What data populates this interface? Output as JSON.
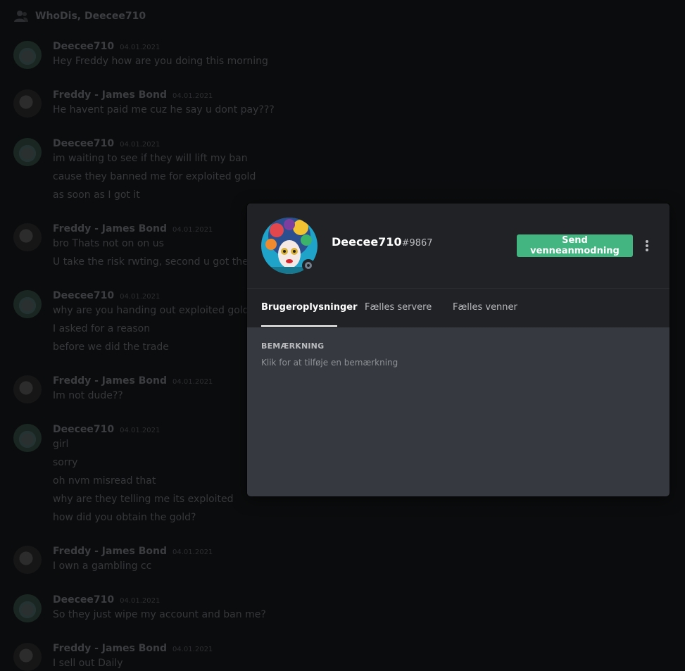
{
  "chat": {
    "header_title": "WhoDis, Deecee710",
    "messages": [
      {
        "author": "Deecee710",
        "time": "04.01.2021",
        "avatar": "deecee",
        "lines": [
          "Hey Freddy how are you doing this morning"
        ]
      },
      {
        "author": "Freddy - James Bond",
        "time": "04.01.2021",
        "avatar": "freddy",
        "lines": [
          "He havent paid me cuz he say u dont pay???"
        ]
      },
      {
        "author": "Deecee710",
        "time": "04.01.2021",
        "avatar": "deecee",
        "lines": [
          "im waiting to see if they will lift my ban",
          "cause they banned me for exploited gold",
          "as soon as I got it"
        ]
      },
      {
        "author": "Freddy - James Bond",
        "time": "04.01.2021",
        "avatar": "freddy",
        "lines": [
          "bro Thats not on on us",
          "U take the risk rwting, second u got the m"
        ]
      },
      {
        "author": "Deecee710",
        "time": "04.01.2021",
        "avatar": "deecee",
        "lines": [
          "why are you handing out exploited gold th",
          "I asked for a reason",
          "before we did the trade"
        ]
      },
      {
        "author": "Freddy - James Bond",
        "time": "04.01.2021",
        "avatar": "freddy",
        "lines": [
          "Im not dude??"
        ]
      },
      {
        "author": "Deecee710",
        "time": "04.01.2021",
        "avatar": "deecee",
        "lines": [
          "girl",
          "sorry",
          "oh nvm misread that",
          "why are they telling me its exploited",
          "how did you obtain the gold?"
        ]
      },
      {
        "author": "Freddy - James Bond",
        "time": "04.01.2021",
        "avatar": "freddy",
        "lines": [
          "I own a gambling cc"
        ]
      },
      {
        "author": "Deecee710",
        "time": "04.01.2021",
        "avatar": "deecee",
        "lines": [
          "So they just wipe my account and ban me?"
        ]
      },
      {
        "author": "Freddy - James Bond",
        "time": "04.01.2021",
        "avatar": "freddy",
        "lines": [
          "I sell out Daily"
        ]
      }
    ]
  },
  "profile": {
    "username": "Deecee710",
    "discriminator": "#9867",
    "status": "offline",
    "status_color": "#747f8d",
    "send_friend_request_label": "Send venneanmodning",
    "button_color": "#43b581",
    "more_icon": "more-vertical-icon",
    "tabs": [
      {
        "label": "Brugeroplysninger",
        "active": true
      },
      {
        "label": "Fælles servere",
        "active": false
      },
      {
        "label": "Fælles venner",
        "active": false
      }
    ],
    "note_label": "BEMÆRKNING",
    "note_placeholder": "Klik for at tilføje en bemærkning"
  }
}
